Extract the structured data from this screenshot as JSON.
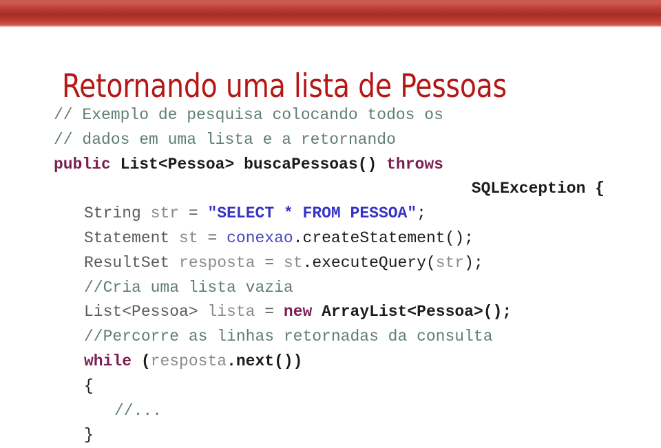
{
  "theme": {
    "bar_color_light": "#c8463c",
    "bar_color_dark": "#a62d27",
    "title_color": "#b51717",
    "comment_color": "#5f7d77",
    "keyword_color": "#7c1d52",
    "string_color": "#3633c4",
    "identifier_color": "#8a8a8a",
    "plain_color": "#1c1c1c"
  },
  "slide": {
    "title": "Retornando uma lista de Pessoas"
  },
  "code": {
    "language": "java",
    "lines": [
      {
        "indent": 0,
        "align": "left",
        "tokens": [
          {
            "text": "// Exemplo de pesquisa colocando todos os",
            "type": "comment"
          }
        ]
      },
      {
        "indent": 0,
        "align": "left",
        "tokens": [
          {
            "text": "// dados em uma lista e a retornando",
            "type": "comment"
          }
        ]
      },
      {
        "indent": 0,
        "align": "left",
        "tokens": [
          {
            "text": "public",
            "type": "keyword"
          },
          {
            "text": " ",
            "type": "plain"
          },
          {
            "text": "List<Pessoa> buscaPessoas()",
            "type": "type"
          },
          {
            "text": " ",
            "type": "plain"
          },
          {
            "text": "throws",
            "type": "keyword"
          }
        ]
      },
      {
        "indent": 0,
        "align": "right",
        "tokens": [
          {
            "text": "SQLException {",
            "type": "type"
          }
        ]
      },
      {
        "indent": 1,
        "align": "left",
        "tokens": [
          {
            "text": "String",
            "type": "dim"
          },
          {
            "text": " ",
            "type": "plain"
          },
          {
            "text": "str",
            "type": "ident"
          },
          {
            "text": " ",
            "type": "plain"
          },
          {
            "text": "=",
            "type": "dim"
          },
          {
            "text": " ",
            "type": "plain"
          },
          {
            "text": "\"SELECT * FROM PESSOA\"",
            "type": "string"
          },
          {
            "text": ";",
            "type": "punct"
          }
        ]
      },
      {
        "indent": 1,
        "align": "left",
        "tokens": [
          {
            "text": "Statement",
            "type": "dim"
          },
          {
            "text": " ",
            "type": "plain"
          },
          {
            "text": "st",
            "type": "ident"
          },
          {
            "text": " ",
            "type": "plain"
          },
          {
            "text": "=",
            "type": "dim"
          },
          {
            "text": " ",
            "type": "plain"
          },
          {
            "text": "conexao",
            "type": "call"
          },
          {
            "text": ".createStatement();",
            "type": "punct"
          }
        ]
      },
      {
        "indent": 1,
        "align": "left",
        "tokens": [
          {
            "text": "ResultSet",
            "type": "dim"
          },
          {
            "text": " ",
            "type": "plain"
          },
          {
            "text": "resposta",
            "type": "ident"
          },
          {
            "text": " ",
            "type": "plain"
          },
          {
            "text": "=",
            "type": "dim"
          },
          {
            "text": " ",
            "type": "plain"
          },
          {
            "text": "st",
            "type": "ident"
          },
          {
            "text": ".executeQuery(",
            "type": "punct"
          },
          {
            "text": "str",
            "type": "ident"
          },
          {
            "text": ");",
            "type": "punct"
          }
        ]
      },
      {
        "indent": 1,
        "align": "left",
        "tokens": [
          {
            "text": "//Cria uma lista vazia",
            "type": "comment"
          }
        ]
      },
      {
        "indent": 1,
        "align": "left",
        "tokens": [
          {
            "text": "List<Pessoa>",
            "type": "dim"
          },
          {
            "text": " ",
            "type": "plain"
          },
          {
            "text": "lista",
            "type": "ident"
          },
          {
            "text": " ",
            "type": "plain"
          },
          {
            "text": "=",
            "type": "dim"
          },
          {
            "text": " ",
            "type": "plain"
          },
          {
            "text": "new",
            "type": "keyword"
          },
          {
            "text": " ",
            "type": "plain"
          },
          {
            "text": "ArrayList<Pessoa>();",
            "type": "type"
          }
        ]
      },
      {
        "indent": 1,
        "align": "left",
        "tokens": [
          {
            "text": "//Percorre as linhas retornadas da consulta",
            "type": "comment"
          }
        ]
      },
      {
        "indent": 1,
        "align": "left",
        "tokens": [
          {
            "text": "while",
            "type": "keyword"
          },
          {
            "text": " ",
            "type": "plain"
          },
          {
            "text": "(",
            "type": "type"
          },
          {
            "text": "resposta",
            "type": "ident"
          },
          {
            "text": ".next())",
            "type": "type"
          }
        ]
      },
      {
        "indent": 1,
        "align": "left",
        "tokens": [
          {
            "text": "{",
            "type": "plain"
          }
        ]
      },
      {
        "indent": 2,
        "align": "left",
        "tokens": [
          {
            "text": "//...",
            "type": "comment"
          }
        ]
      },
      {
        "indent": 1,
        "align": "left",
        "tokens": [
          {
            "text": "}",
            "type": "plain"
          }
        ]
      }
    ]
  }
}
